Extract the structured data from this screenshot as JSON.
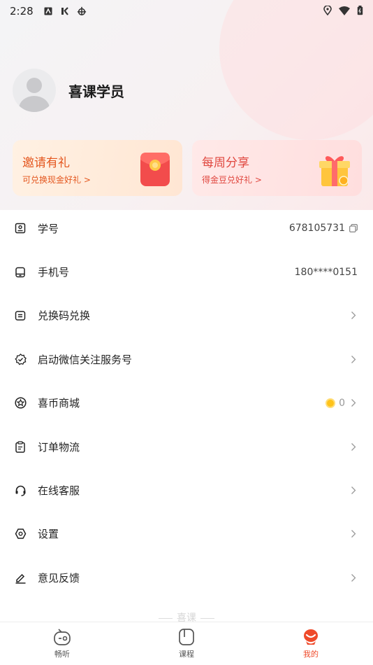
{
  "status_bar": {
    "time": "2:28"
  },
  "profile": {
    "username": "喜课学员"
  },
  "promos": [
    {
      "title": "邀请有礼",
      "subtitle": "可兑换现金好礼 >"
    },
    {
      "title": "每周分享",
      "subtitle": "得金豆兑好礼 >"
    }
  ],
  "menu": {
    "student_id": {
      "label": "学号",
      "value": "678105731"
    },
    "phone": {
      "label": "手机号",
      "value": "180****0151"
    },
    "redeem": {
      "label": "兑换码兑换"
    },
    "wechat": {
      "label": "启动微信关注服务号"
    },
    "mall": {
      "label": "喜币商城",
      "value": "0"
    },
    "orders": {
      "label": "订单物流"
    },
    "service": {
      "label": "在线客服"
    },
    "settings": {
      "label": "设置"
    },
    "feedback": {
      "label": "意见反馈"
    }
  },
  "footer": {
    "brand": "喜课"
  },
  "tabs": [
    {
      "label": "畅听"
    },
    {
      "label": "课程"
    },
    {
      "label": "我的"
    }
  ],
  "colors": {
    "accent": "#ef4a2a",
    "coin": "#ffc31a"
  }
}
